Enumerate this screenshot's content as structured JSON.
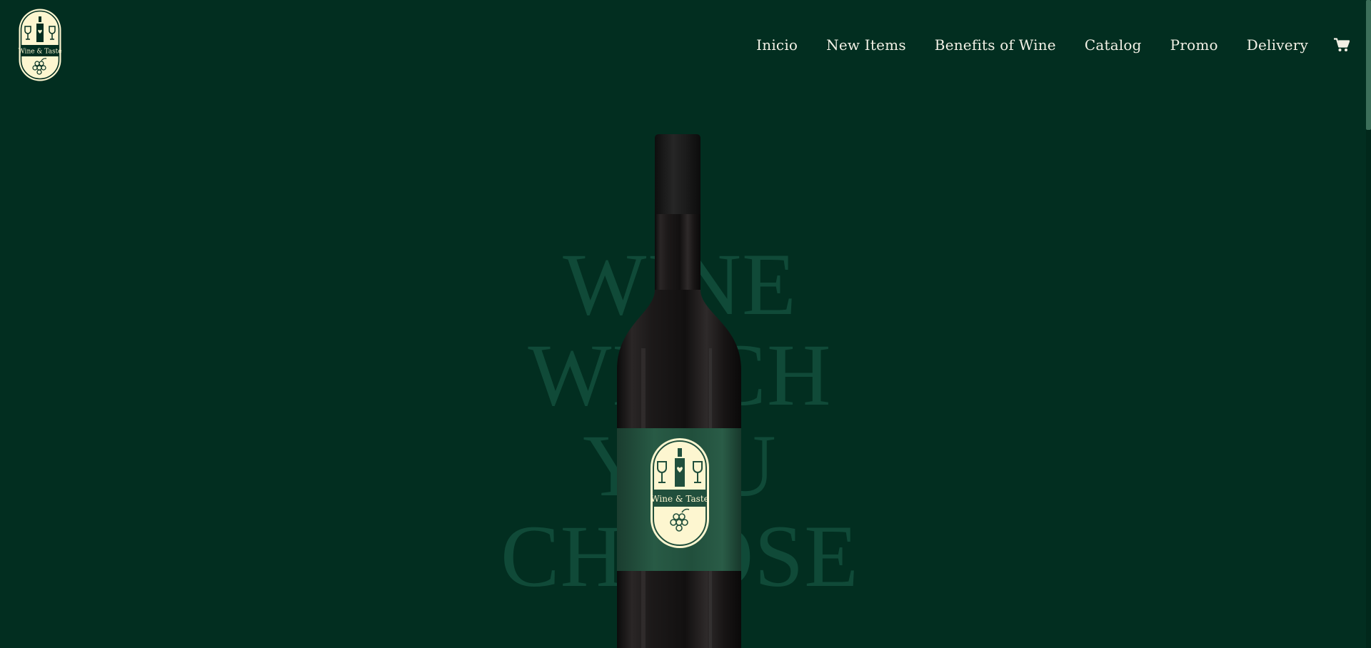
{
  "brand": {
    "logo_text": "Wine & Taste",
    "label_text": "Wine & Taste"
  },
  "nav": {
    "items": [
      {
        "label": "Inicio"
      },
      {
        "label": "New Items"
      },
      {
        "label": "Benefits of Wine"
      },
      {
        "label": "Catalog"
      },
      {
        "label": "Promo"
      },
      {
        "label": "Delivery"
      }
    ],
    "cart_icon": "cart-icon"
  },
  "hero": {
    "headline_lines": [
      "Wine",
      "Which",
      "You",
      "Choose"
    ]
  },
  "colors": {
    "background": "#022e20",
    "headline": "#104a38",
    "nav_text": "#f3f1e6",
    "label_green": "#214f3c",
    "label_cream": "#fdf6d0"
  }
}
